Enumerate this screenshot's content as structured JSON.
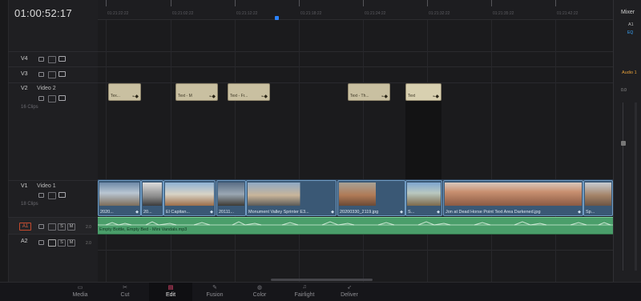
{
  "timecode": "01:00:52:17",
  "ruler": {
    "ticks": [
      "01:21:22:22",
      "01:21:02:22",
      "01:21:12:22",
      "01:21:18:22",
      "01:21:24:22",
      "01:21:32:22",
      "01:21:35:22",
      "01:21:42:22"
    ]
  },
  "tracks": {
    "v4": {
      "name": "V4"
    },
    "v3": {
      "name": "V3"
    },
    "v2": {
      "name": "V2",
      "title": "Video 2",
      "clips": "16 Clips"
    },
    "v1": {
      "name": "V1",
      "title": "Video 1",
      "clips": "18 Clips"
    },
    "a1": {
      "name": "A1",
      "vol": "2.0",
      "s": "S",
      "m": "M"
    },
    "a2": {
      "name": "A2",
      "vol": "2.0",
      "s": "S",
      "m": "M"
    }
  },
  "title_clips": [
    "Tex...",
    "Text - M",
    "Text - Fr...",
    "Text - Th...",
    "Text"
  ],
  "video_clips": [
    "2020...",
    "20...",
    "El Capitan...",
    "20111...",
    "Monument Valley Sprinter E3...",
    "20200330_2119.jpg",
    "S...",
    "Jon at Dead Horse Point Text Area Darkened.jpg",
    "Sp..."
  ],
  "audio_clip": "Empty Bottle, Empty Bed - Mini Vandals.mp3",
  "mixer": {
    "title": "Mixer",
    "channel": "A1",
    "eq": "EQ",
    "track": "Audio 1",
    "value": "0.0"
  },
  "pages": [
    {
      "label": "Media",
      "icon": "▭"
    },
    {
      "label": "Cut",
      "icon": "✂"
    },
    {
      "label": "Edit",
      "icon": "▤"
    },
    {
      "label": "Fusion",
      "icon": "✎"
    },
    {
      "label": "Color",
      "icon": "◍"
    },
    {
      "label": "Fairlight",
      "icon": "♫"
    },
    {
      "label": "Deliver",
      "icon": "➶"
    }
  ],
  "active_page": "Edit",
  "colors": {
    "video_clip": "#3a5875",
    "title_clip": "#c9c0a1",
    "audio_clip": "#4a9e6a",
    "playhead": "#2a82ff"
  }
}
